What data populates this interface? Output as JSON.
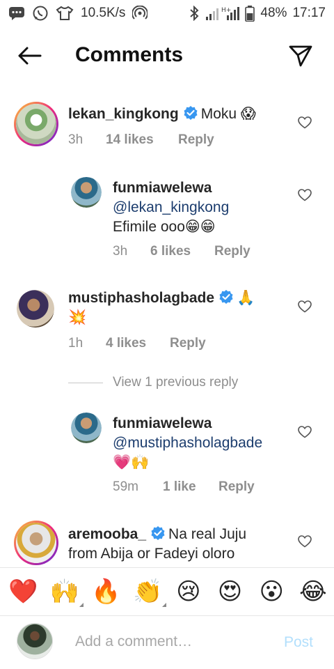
{
  "status_bar": {
    "speed": "10.5K/s",
    "battery": "48%",
    "time": "17:17",
    "icons": [
      "message-icon",
      "whatsapp-icon",
      "shirt-icon",
      "hotspot-icon",
      "bluetooth-icon",
      "signal-icon",
      "battery-icon"
    ]
  },
  "header": {
    "title": "Comments",
    "back_icon": "arrow-left-icon",
    "share_icon": "paper-plane-icon"
  },
  "comments": [
    {
      "user": "lekan_kingkong",
      "verified": true,
      "text": "Moku 😱",
      "time": "3h",
      "likes": "14 likes",
      "reply": "Reply"
    },
    {
      "user": "funmiawelewa",
      "verified": false,
      "mention": "@lekan_kingkong",
      "text": "Efimile ooo😁😁",
      "time": "3h",
      "likes": "6 likes",
      "reply": "Reply"
    },
    {
      "user": "mustiphasholagbade",
      "verified": true,
      "text": "🙏",
      "text2": "💥",
      "time": "1h",
      "likes": "4 likes",
      "reply": "Reply"
    },
    {
      "user": "funmiawelewa",
      "verified": false,
      "mention": "@mustiphasholagbade",
      "text": "💗🙌",
      "time": "59m",
      "likes": "1 like",
      "reply": "Reply"
    },
    {
      "user": "aremooba_",
      "verified": true,
      "text": "Na real Juju",
      "text2": "from Abija or Fadeyi oloro"
    }
  ],
  "view_previous": "View 1 previous reply",
  "emoji_bar": [
    "❤️",
    "🙌",
    "🔥",
    "👏",
    "😢",
    "😍",
    "😮",
    "😂"
  ],
  "composer": {
    "placeholder": "Add a comment…",
    "post_label": "Post"
  },
  "colors": {
    "verified": "#3897f0",
    "mention": "#1c3d6e",
    "post_disabled": "#b2dffc",
    "meta_gray": "#8e8e8e"
  }
}
